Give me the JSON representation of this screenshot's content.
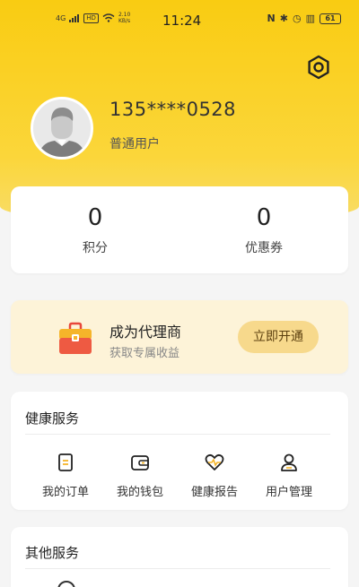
{
  "status_bar": {
    "network": "4G",
    "hd": "HD",
    "speed": "2.10 KB/s",
    "time": "11:24",
    "icons": [
      "nfc-icon",
      "bluetooth-icon",
      "alarm-icon",
      "vibrate-icon"
    ],
    "battery": "61"
  },
  "header": {
    "settings_icon": "gear-icon"
  },
  "profile": {
    "phone": "135****0528",
    "user_type": "普通用户"
  },
  "stats": [
    {
      "value": "0",
      "label": "积分"
    },
    {
      "value": "0",
      "label": "优惠券"
    }
  ],
  "agent": {
    "title": "成为代理商",
    "subtitle": "获取专属收益",
    "button": "立即开通"
  },
  "health_services": {
    "title": "健康服务",
    "items": [
      {
        "label": "我的订单",
        "icon": "order-icon"
      },
      {
        "label": "我的钱包",
        "icon": "wallet-icon"
      },
      {
        "label": "健康报告",
        "icon": "heart-pulse-icon"
      },
      {
        "label": "用户管理",
        "icon": "user-icon"
      }
    ]
  },
  "other_services": {
    "title": "其他服务"
  },
  "colors": {
    "brand_yellow": "#f9cc12",
    "agent_bg": "#fdf3d8",
    "agent_button": "#f7d98c"
  }
}
